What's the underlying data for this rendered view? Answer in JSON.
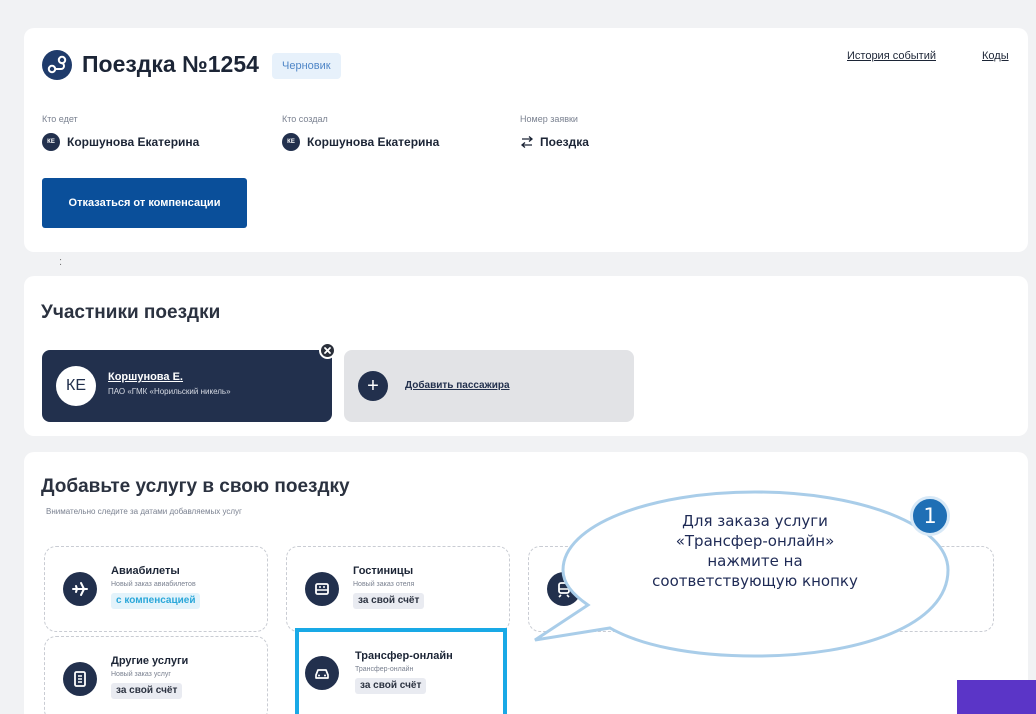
{
  "trip": {
    "title": "Поездка №1254",
    "status": "Черновик",
    "links": {
      "history": "История событий",
      "codes": "Коды"
    },
    "who_goes_label": "Кто едет",
    "who_goes_initials": "КЕ",
    "who_goes_value": "Коршунова Екатерина",
    "created_by_label": "Кто создал",
    "created_by_initials": "КЕ",
    "created_by_value": "Коршунова Екатерина",
    "request_number_label": "Номер заявки",
    "request_number_value": "Поездка",
    "refuse_button": "Отказаться от компенсации",
    "colon": ":"
  },
  "participants": {
    "title": "Участники поездки",
    "person": {
      "initials": "КЕ",
      "name": "Коршунова Е.",
      "org": "ПАО «ГМК «Норильский никель»"
    },
    "add_label": "Добавить пассажира",
    "add_symbol": "+"
  },
  "services": {
    "title": "Добавьте услугу в свою поездку",
    "hint": "Внимательно следите за датами добавляемых услуг",
    "items": [
      {
        "title": "Авиабилеты",
        "subtitle": "Новый заказ авиабилетов",
        "tag": "с компенсацией",
        "icon": "plane-icon"
      },
      {
        "title": "Гостиницы",
        "subtitle": "Новый заказ отеля",
        "tag": "за свой счёт",
        "icon": "hotel-icon"
      },
      {
        "title": "Другие услуги",
        "subtitle": "Новый заказ услуг",
        "tag": "за свой счёт",
        "icon": "document-icon"
      },
      {
        "title": "Трансфер-онлайн",
        "subtitle": "Трансфер-онлайн",
        "tag": "за свой счёт",
        "icon": "car-icon"
      }
    ]
  },
  "callout": {
    "step": "1",
    "text": "Для заказа услуги «Трансфер-онлайн» нажмите на соответствующую кнопку"
  },
  "colors": {
    "primary": "#0a4f9a",
    "dark_navy": "#22304d",
    "highlight": "#19a9e6",
    "comp_tag": "#2aa7d9",
    "callout_fill": "#ffffff",
    "callout_border": "#a9cde9",
    "purple": "#5b35c7"
  }
}
